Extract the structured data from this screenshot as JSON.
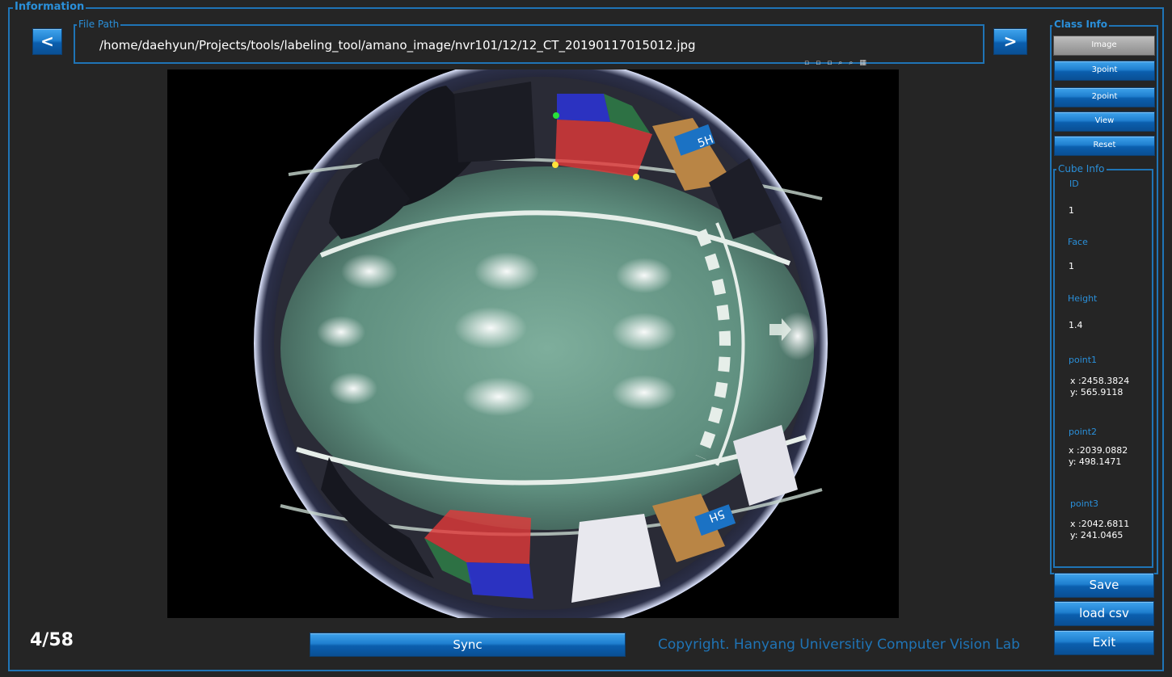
{
  "information_label": "Information",
  "file_path": {
    "label": "File Path",
    "value": "/home/daehyun/Projects/tools/labeling_tool/amano_image/nvr101/12/12_CT_20190117015012.jpg"
  },
  "nav": {
    "prev": "<",
    "next": ">"
  },
  "class_info": {
    "label": "Class Info",
    "buttons": [
      "Image",
      "3point",
      "2point",
      "View",
      "Reset"
    ]
  },
  "cube_info": {
    "label": "Cube Info",
    "id_label": "ID",
    "id_value": "1",
    "face_label": "Face",
    "face_value": "1",
    "height_label": "Height",
    "height_value": "1.4",
    "point1_label": "point1",
    "point1_x": "x :2458.3824",
    "point1_y": "y: 565.9118",
    "point2_label": "point2",
    "point2_x": "x :2039.0882",
    "point2_y": "y: 498.1471",
    "point3_label": "point3",
    "point3_x": "x :2042.6811",
    "point3_y": "y: 241.0465"
  },
  "actions": {
    "save": "Save",
    "load": "load csv",
    "exit": "Exit",
    "sync": "Sync"
  },
  "counter": "4/58",
  "copyright": "Copyright. Hanyang Universitiy Computer Vision Lab",
  "colors": {
    "accent": "#1f74b6",
    "floor": "#6f9f8e",
    "cube_red": "#e23a3a",
    "cube_blue": "#2b34d9",
    "cube_green": "#2f8a4a"
  }
}
